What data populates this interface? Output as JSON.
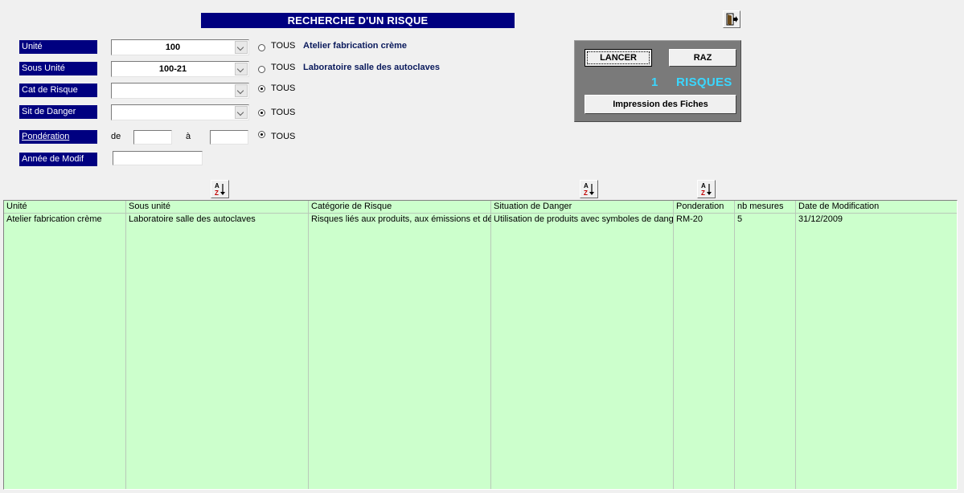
{
  "title": "RECHERCHE D'UN RISQUE",
  "filters": {
    "unite": {
      "label": "Unité",
      "value": "100",
      "tous": "TOUS",
      "tous_selected": false,
      "description": "Atelier fabrication crème"
    },
    "sous_unite": {
      "label": "Sous Unité",
      "value": "100-21",
      "tous": "TOUS",
      "tous_selected": false,
      "description": "Laboratoire salle des autoclaves"
    },
    "cat_risque": {
      "label": "Cat de Risque",
      "value": "",
      "tous": "TOUS",
      "tous_selected": true
    },
    "sit_danger": {
      "label": "Sit de Danger",
      "value": "",
      "tous": "TOUS",
      "tous_selected": true
    },
    "ponderation": {
      "label": "Pondération",
      "de_label": "de",
      "a_label": "à",
      "de_value": "",
      "a_value": "",
      "tous": "TOUS",
      "tous_selected": true
    },
    "annee_modif": {
      "label": "Année de Modif",
      "value": ""
    }
  },
  "panel": {
    "lancer_label": "LANCER",
    "raz_label": "RAZ",
    "count": "1",
    "count_label": "RISQUES",
    "impression_label": "Impression des Fiches"
  },
  "table": {
    "columns": [
      "Unité",
      "Sous unité",
      "Catégorie de Risque",
      "Situation de Danger",
      "Ponderation",
      "nb mesures",
      "Date de Modification"
    ],
    "rows": [
      [
        "Atelier fabrication crème",
        "Laboratoire salle des autoclaves",
        "Risques liés aux produits, aux émissions et déc",
        "Utilisation de produits avec symboles de dange",
        "RM-20",
        "5",
        "31/12/2009"
      ]
    ]
  },
  "icons": {
    "exit": "exit-door-icon",
    "sort": "sort-az-icon"
  },
  "colors": {
    "title_bg": "#000080",
    "grid_bg": "#ccffcc",
    "count_color": "#3ad7ff",
    "panel_bg": "#7a7a7a"
  }
}
